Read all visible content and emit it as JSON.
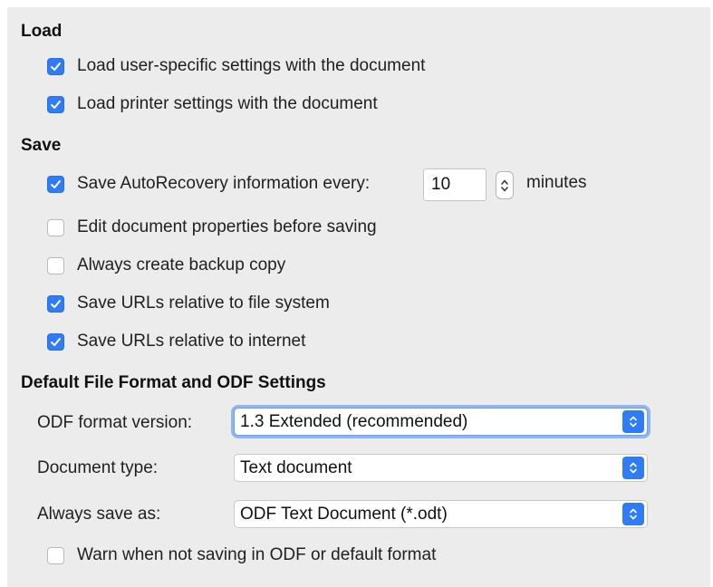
{
  "load": {
    "title": "Load",
    "options": [
      {
        "label": "Load user-specific settings with the document",
        "checked": true
      },
      {
        "label": "Load printer settings with the document",
        "checked": true
      }
    ]
  },
  "save": {
    "title": "Save",
    "autorecovery": {
      "label": "Save AutoRecovery information every:",
      "checked": true,
      "value": "10",
      "unit": "minutes"
    },
    "options": [
      {
        "label": "Edit document properties before saving",
        "checked": false
      },
      {
        "label": "Always create backup copy",
        "checked": false
      },
      {
        "label": "Save URLs relative to file system",
        "checked": true
      },
      {
        "label": "Save URLs relative to internet",
        "checked": true
      }
    ]
  },
  "default_format": {
    "title": "Default File Format and ODF Settings",
    "odf_version": {
      "label": "ODF format version:",
      "value": "1.3 Extended (recommended)"
    },
    "document_type": {
      "label": "Document type:",
      "value": "Text document"
    },
    "always_save_as": {
      "label": "Always save as:",
      "value": "ODF Text Document (*.odt)"
    },
    "warn": {
      "label": "Warn when not saving in ODF or default format",
      "checked": false
    }
  },
  "colors": {
    "accent": "#2f7cf6",
    "panel_bg": "#ececec"
  }
}
